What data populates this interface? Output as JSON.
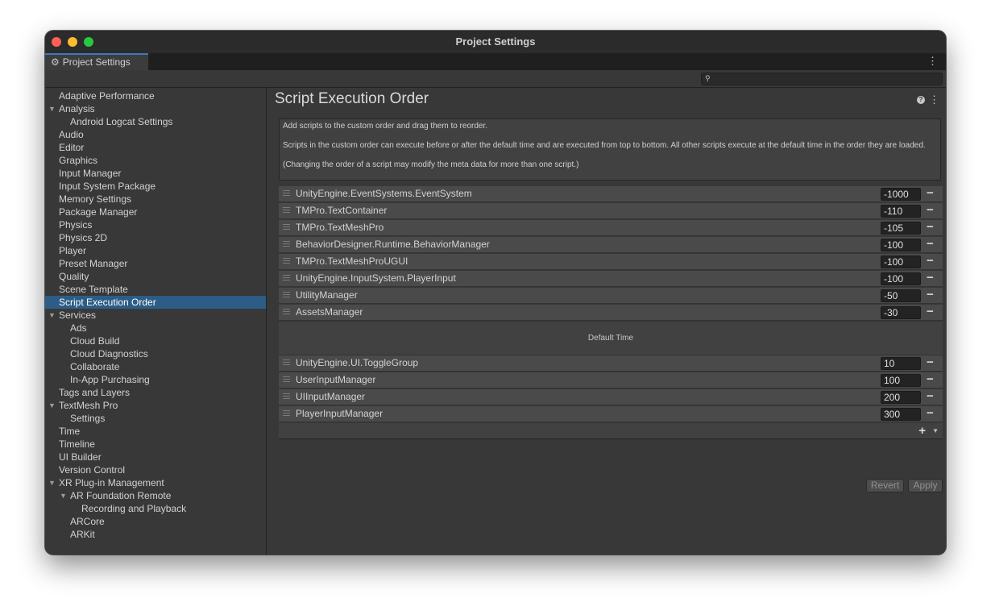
{
  "window": {
    "title": "Project Settings"
  },
  "tab": {
    "label": "Project Settings",
    "icon": "gear-icon"
  },
  "search": {
    "placeholder": "",
    "value": ""
  },
  "sidebar": {
    "items": [
      {
        "label": "Adaptive Performance",
        "indent": 0
      },
      {
        "label": "Analysis",
        "indent": 0,
        "expanded": true
      },
      {
        "label": "Android Logcat Settings",
        "indent": 1
      },
      {
        "label": "Audio",
        "indent": 0
      },
      {
        "label": "Editor",
        "indent": 0
      },
      {
        "label": "Graphics",
        "indent": 0
      },
      {
        "label": "Input Manager",
        "indent": 0
      },
      {
        "label": "Input System Package",
        "indent": 0
      },
      {
        "label": "Memory Settings",
        "indent": 0
      },
      {
        "label": "Package Manager",
        "indent": 0
      },
      {
        "label": "Physics",
        "indent": 0
      },
      {
        "label": "Physics 2D",
        "indent": 0
      },
      {
        "label": "Player",
        "indent": 0
      },
      {
        "label": "Preset Manager",
        "indent": 0
      },
      {
        "label": "Quality",
        "indent": 0
      },
      {
        "label": "Scene Template",
        "indent": 0
      },
      {
        "label": "Script Execution Order",
        "indent": 0,
        "selected": true
      },
      {
        "label": "Services",
        "indent": 0,
        "expanded": true
      },
      {
        "label": "Ads",
        "indent": 1
      },
      {
        "label": "Cloud Build",
        "indent": 1
      },
      {
        "label": "Cloud Diagnostics",
        "indent": 1
      },
      {
        "label": "Collaborate",
        "indent": 1
      },
      {
        "label": "In-App Purchasing",
        "indent": 1
      },
      {
        "label": "Tags and Layers",
        "indent": 0
      },
      {
        "label": "TextMesh Pro",
        "indent": 0,
        "expanded": true
      },
      {
        "label": "Settings",
        "indent": 1
      },
      {
        "label": "Time",
        "indent": 0
      },
      {
        "label": "Timeline",
        "indent": 0
      },
      {
        "label": "UI Builder",
        "indent": 0
      },
      {
        "label": "Version Control",
        "indent": 0
      },
      {
        "label": "XR Plug-in Management",
        "indent": 0,
        "expanded": true
      },
      {
        "label": "AR Foundation Remote",
        "indent": 1,
        "expanded": true
      },
      {
        "label": "Recording and Playback",
        "indent": 2
      },
      {
        "label": "ARCore",
        "indent": 1
      },
      {
        "label": "ARKit",
        "indent": 1
      }
    ]
  },
  "main": {
    "title": "Script Execution Order",
    "info": [
      "Add scripts to the custom order and drag them to reorder.",
      "Scripts in the custom order can execute before or after the default time and are executed from top to bottom. All other scripts execute at the default time in the order they are loaded.",
      "(Changing the order of a script may modify the meta data for more than one script.)"
    ],
    "before_default": [
      {
        "name": "UnityEngine.EventSystems.EventSystem",
        "order": "-1000"
      },
      {
        "name": "TMPro.TextContainer",
        "order": "-110"
      },
      {
        "name": "TMPro.TextMeshPro",
        "order": "-105"
      },
      {
        "name": "BehaviorDesigner.Runtime.BehaviorManager",
        "order": "-100"
      },
      {
        "name": "TMPro.TextMeshProUGUI",
        "order": "-100"
      },
      {
        "name": "UnityEngine.InputSystem.PlayerInput",
        "order": "-100"
      },
      {
        "name": "UtilityManager",
        "order": "-50"
      },
      {
        "name": "AssetsManager",
        "order": "-30"
      }
    ],
    "default_time_label": "Default Time",
    "after_default": [
      {
        "name": "UnityEngine.UI.ToggleGroup",
        "order": "10"
      },
      {
        "name": "UserInputManager",
        "order": "100"
      },
      {
        "name": "UIInputManager",
        "order": "200"
      },
      {
        "name": "PlayerInputManager",
        "order": "300"
      }
    ],
    "revert_label": "Revert",
    "apply_label": "Apply"
  },
  "colors": {
    "selection": "#2c5d87",
    "background": "#383838",
    "row": "#4a4a4a",
    "close": "#fe5f57",
    "minimize": "#febc2e",
    "maximize": "#28c840"
  }
}
